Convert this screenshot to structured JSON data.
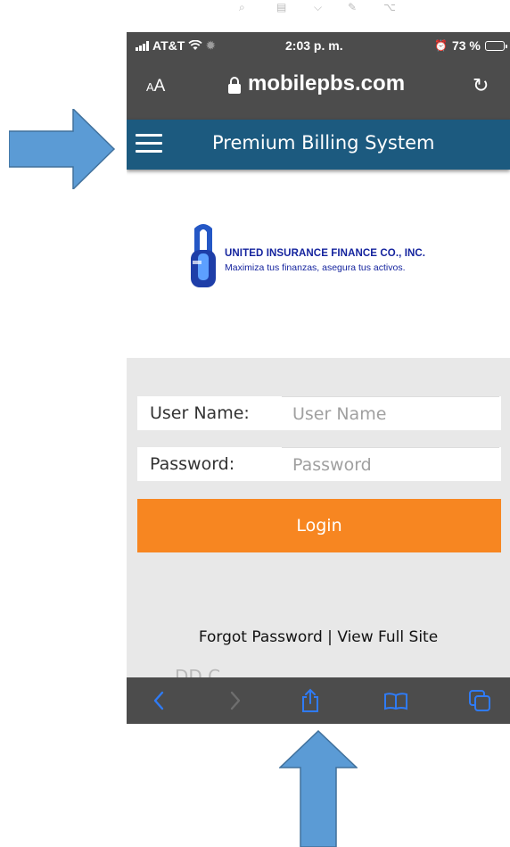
{
  "status_bar": {
    "carrier": "AT&T",
    "time": "2:03 p. m.",
    "battery": "73 %",
    "battery_level": 0.73
  },
  "browser": {
    "text_size_button": "AA",
    "url": "mobilepbs.com"
  },
  "app_header": {
    "title": "Premium Billing System"
  },
  "logo": {
    "company": "UNITED INSURANCE FINANCE CO., INC.",
    "slogan": "Maximiza tus finanzas, asegura tus activos."
  },
  "login_form": {
    "username_label": "User Name:",
    "username_placeholder": "User Name",
    "username_value": "",
    "password_label": "Password:",
    "password_placeholder": "Password",
    "password_value": "",
    "login_button": "Login",
    "forgot_password": "Forgot Password",
    "separator": " | ",
    "view_full_site": "View Full Site",
    "partial_text": "DD C"
  },
  "safari_toolbar": {
    "buttons": [
      "back-icon",
      "forward-icon",
      "share-icon",
      "bookmarks-icon",
      "tabs-icon"
    ]
  },
  "colors": {
    "browser_chrome": "#4c4c4c",
    "header": "#1c5a7f",
    "login_button": "#f78621",
    "panel": "#e8e8e8",
    "safari_icons": "#2f7bf5",
    "annotation_arrow": "#5b9bd5",
    "logo_text": "#15249e"
  }
}
